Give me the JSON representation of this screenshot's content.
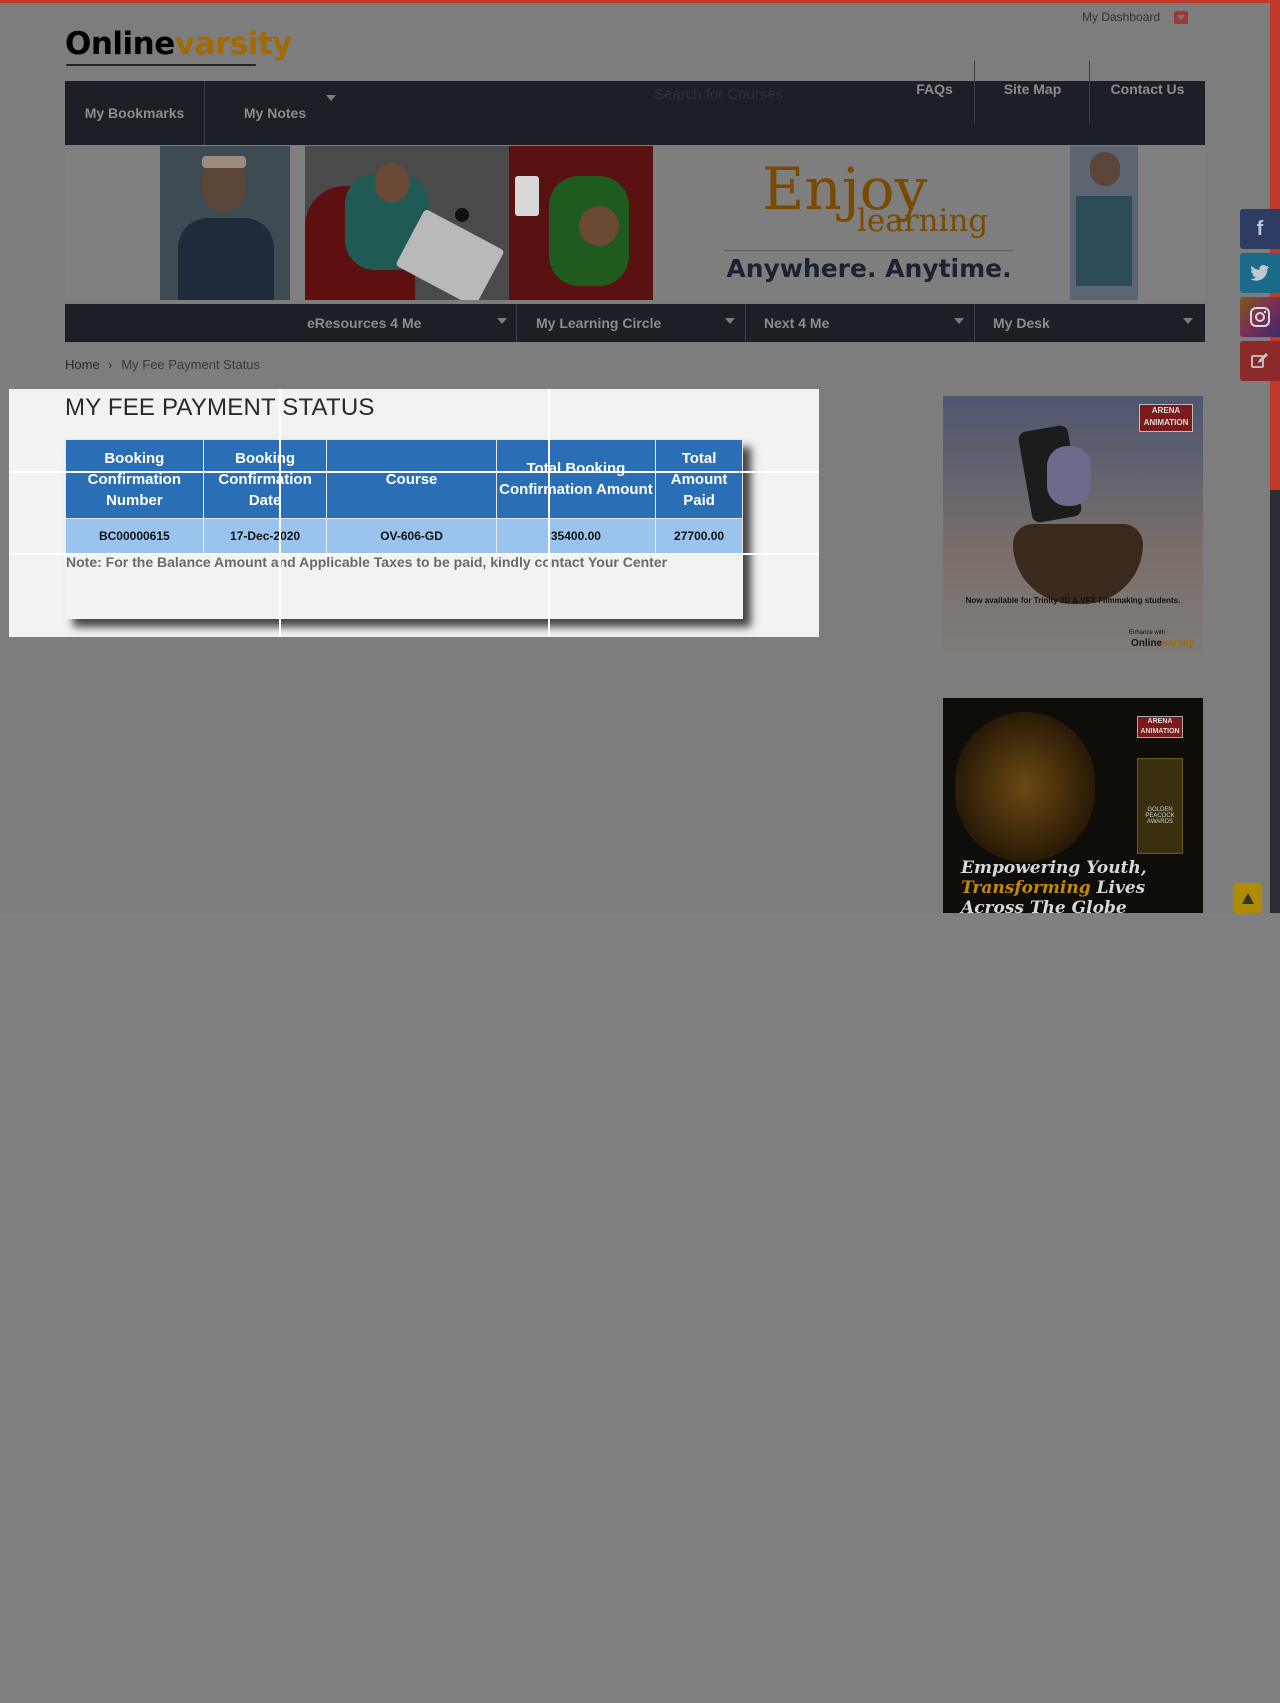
{
  "header": {
    "dashboard_link": "My Dashboard",
    "logo_part1": "Online",
    "logo_part2": "varsity"
  },
  "nav_primary": {
    "items": [
      "My Bookmarks",
      "My Notes"
    ],
    "search_placeholder": "Search for Courses",
    "right_links": [
      "FAQs",
      "Site Map",
      "Contact Us"
    ]
  },
  "banner": {
    "enjoy": "Enjoy",
    "learning": "learning",
    "tagline": "Anywhere. Anytime."
  },
  "nav_secondary": {
    "items": [
      "eResources 4 Me",
      "My Learning Circle",
      "Next 4 Me",
      "My Desk"
    ]
  },
  "breadcrumb": {
    "home": "Home",
    "current": "My Fee Payment Status"
  },
  "main": {
    "title": "MY FEE PAYMENT STATUS",
    "table": {
      "headers": [
        "Booking Confirmation Number",
        "Booking Confirmation Date",
        "Course",
        "Total Booking Confirmation Amount",
        "Total Amount Paid"
      ],
      "rows": [
        [
          "BC00000615",
          "17-Dec-2020",
          "OV-606-GD",
          "35400.00",
          "27700.00"
        ]
      ]
    },
    "note": "Note: For the Balance Amount and Applicable Taxes to be paid, kindly contact Your Center"
  },
  "sidebar_ads": [
    {
      "brand": "ARENA ANIMATION",
      "headline": "Now available for Trinity 3D & VFX Filmmaking students.",
      "footer": "Enhance with",
      "footer_logo_part1": "Online",
      "footer_logo_part2": "varsity"
    },
    {
      "brand": "ARENA ANIMATION",
      "award": "GOLDEN PEACOCK AWARDS",
      "headline_line1": "Empowering Youth,",
      "headline_word_transforming": "Transforming",
      "headline_word_lives": "Lives",
      "headline_line3": "Across The Globe"
    }
  ],
  "social": [
    "facebook-icon",
    "twitter-icon",
    "instagram-icon",
    "edit-icon"
  ],
  "colors": {
    "nav_bg": "#1c1f25",
    "table_header": "#2a6eb5",
    "table_row": "#9ac4ee",
    "accent_red": "#c0392b",
    "facebook": "#2d3c62",
    "twitter": "#1a6a8a",
    "instagram": "#7a2f55",
    "edit": "#8c2a2a",
    "warning": "#b08a00"
  }
}
